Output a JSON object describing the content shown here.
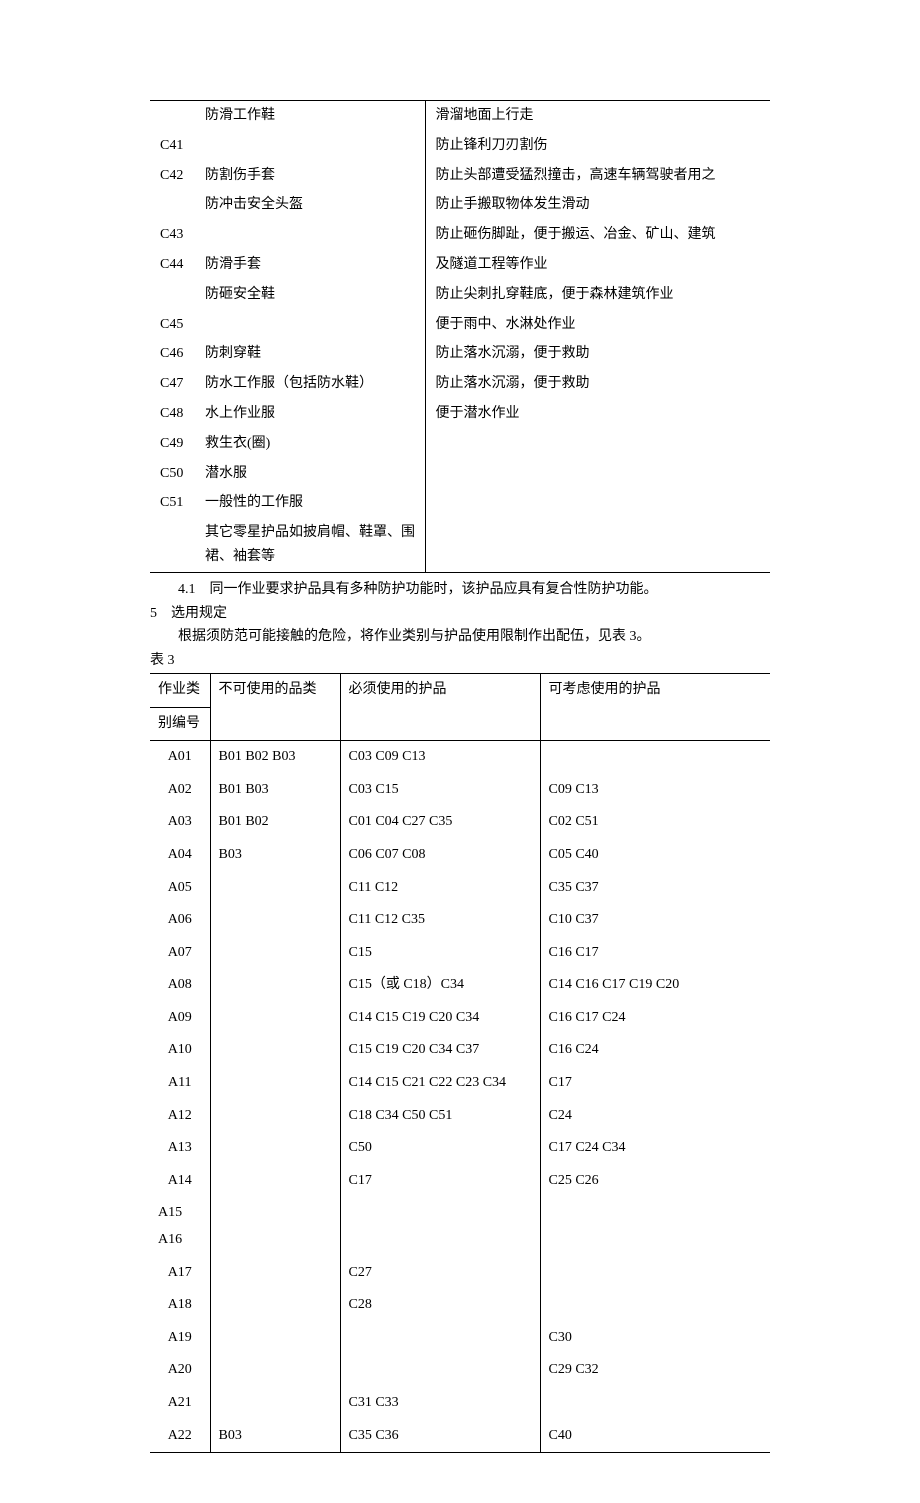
{
  "topTable": {
    "rows": [
      {
        "code": "",
        "name": "防滑工作鞋",
        "desc": "滑溜地面上行走"
      },
      {
        "code": "C41",
        "name": "",
        "desc": "防止锋利刀刃割伤"
      },
      {
        "code": "C42",
        "name": "防割伤手套",
        "desc": "防止头部遭受猛烈撞击，高速车辆驾驶者用之"
      },
      {
        "code": "",
        "name": "防冲击安全头盔",
        "desc": "防止手搬取物体发生滑动"
      },
      {
        "code": "C43",
        "name": "",
        "desc": "防止砸伤脚趾，便于搬运、冶金、矿山、建筑"
      },
      {
        "code": "C44",
        "name": "防滑手套",
        "desc": "及隧道工程等作业"
      },
      {
        "code": "",
        "name": "防砸安全鞋",
        "desc": "防止尖刺扎穿鞋底，便于森林建筑作业"
      },
      {
        "code": "C45",
        "name": "",
        "desc": "便于雨中、水淋处作业"
      },
      {
        "code": "C46",
        "name": "防刺穿鞋",
        "desc": "防止落水沉溺，便于救助"
      },
      {
        "code": "C47",
        "name": "防水工作服（包括防水鞋）",
        "desc": "防止落水沉溺，便于救助"
      },
      {
        "code": "C48",
        "name": "水上作业服",
        "desc": "便于潜水作业"
      },
      {
        "code": "C49",
        "name": "救生衣(圈)",
        "desc": ""
      },
      {
        "code": "C50",
        "name": "潜水服",
        "desc": ""
      },
      {
        "code": "C51",
        "name": "一般性的工作服",
        "desc": ""
      },
      {
        "code": "",
        "name": "其它零星护品如披肩帽、鞋罩、围裙、袖套等",
        "desc": ""
      }
    ]
  },
  "paragraphs": {
    "p41": "　　4.1　同一作业要求护品具有多种防护功能时，该护品应具有复合性防护功能。",
    "p5": "5　选用规定",
    "p5desc": "　　根据须防范可能接触的危险，将作业类别与护品使用限制作出配伍，见表 3。",
    "table3label": "表 3"
  },
  "bottomTable": {
    "headers": {
      "h1a": "作业类",
      "h1b": "别编号",
      "h2": "不可使用的品类",
      "h3": "必须使用的护品",
      "h4": "可考虑使用的护品"
    },
    "rows": [
      {
        "c1": "A01",
        "c2": "B01 B02 B03",
        "c3": "C03 C09 C13",
        "c4": ""
      },
      {
        "c1": "A02",
        "c2": "B01 B03",
        "c3": "C03 C15",
        "c4": "C09 C13"
      },
      {
        "c1": "A03",
        "c2": "B01 B02",
        "c3": "C01 C04 C27 C35",
        "c4": "C02 C51"
      },
      {
        "c1": "A04",
        "c2": "B03",
        "c3": "C06 C07 C08",
        "c4": "C05 C40"
      },
      {
        "c1": "A05",
        "c2": "",
        "c3": "C11 C12",
        "c4": "C35 C37"
      },
      {
        "c1": "A06",
        "c2": "",
        "c3": "C11 C12 C35",
        "c4": "C10 C37"
      },
      {
        "c1": "A07",
        "c2": "",
        "c3": "C15",
        "c4": "C16 C17"
      },
      {
        "c1": "A08",
        "c2": "",
        "c3": "C15（或 C18）C34",
        "c4": "C14 C16 C17 C19 C20"
      },
      {
        "c1": "A09",
        "c2": "",
        "c3": "C14 C15 C19 C20 C34",
        "c4": "C16 C17 C24"
      },
      {
        "c1": "A10",
        "c2": "",
        "c3": "C15 C19 C20 C34 C37",
        "c4": "C16 C24"
      },
      {
        "c1": "A11",
        "c2": "",
        "c3": "C14 C15 C21 C22 C23 C34",
        "c4": "C17"
      },
      {
        "c1": "A12",
        "c2": "",
        "c3": "C18 C34 C50 C51",
        "c4": "C24"
      },
      {
        "c1": "A13",
        "c2": "",
        "c3": "C50",
        "c4": "C17 C24 C34"
      },
      {
        "c1": "A14",
        "c2": "",
        "c3": "C17",
        "c4": "C25 C26"
      },
      {
        "c1": "A15　A16",
        "c2": "",
        "c3": "",
        "c4": ""
      },
      {
        "c1": "A17",
        "c2": "",
        "c3": "C27",
        "c4": ""
      },
      {
        "c1": "A18",
        "c2": "",
        "c3": "C28",
        "c4": ""
      },
      {
        "c1": "A19",
        "c2": "",
        "c3": "",
        "c4": "C30"
      },
      {
        "c1": "A20",
        "c2": "",
        "c3": "",
        "c4": "C29 C32"
      },
      {
        "c1": "A21",
        "c2": "",
        "c3": "C31 C33",
        "c4": ""
      },
      {
        "c1": "A22",
        "c2": "B03",
        "c3": "C35 C36",
        "c4": "C40"
      }
    ]
  }
}
